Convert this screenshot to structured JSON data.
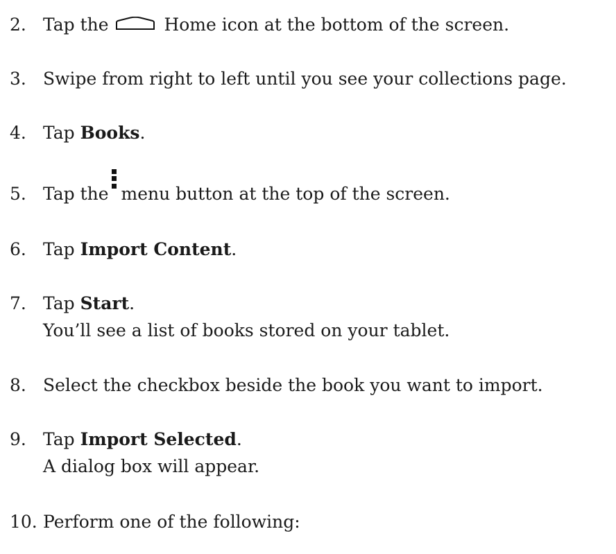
{
  "steps": [
    {
      "number": "2.",
      "before": "Tap the",
      "icon": "home-icon",
      "after": "Home icon at the bottom of the screen."
    },
    {
      "number": "3.",
      "text": "Swipe from right to left until you see your collections page."
    },
    {
      "number": "4.",
      "before": "Tap ",
      "bold": "Books",
      "after": "."
    },
    {
      "number": "5.",
      "before": "Tap the",
      "icon": "menu-icon",
      "after": "menu button at the top of the screen."
    },
    {
      "number": "6.",
      "before": "Tap ",
      "bold": "Import Content",
      "after": "."
    },
    {
      "number": "7.",
      "before": "Tap ",
      "bold": "Start",
      "after": ".",
      "sub": "You’ll see a list of books stored on your tablet."
    },
    {
      "number": "8.",
      "text": "Select the checkbox beside the book you want to import."
    },
    {
      "number": "9.",
      "before": "Tap ",
      "bold": "Import Selected",
      "after": ".",
      "sub": "A dialog box will appear."
    },
    {
      "number": "10.",
      "text": "Perform one of the following:"
    }
  ]
}
